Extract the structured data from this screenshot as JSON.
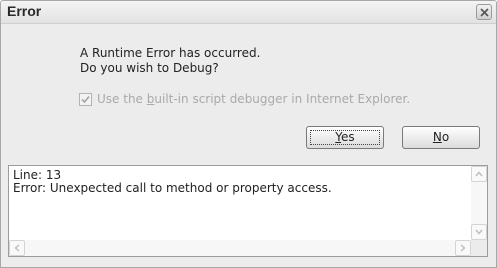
{
  "window": {
    "title": "Error"
  },
  "message": {
    "line1": "A Runtime Error has occurred.",
    "line2": "Do you wish to Debug?"
  },
  "debugger_option": {
    "label_pre": "Use the ",
    "label_hotkey": "b",
    "label_post": "uilt-in script debugger in Internet Explorer.",
    "checked": true,
    "enabled": false
  },
  "buttons": {
    "yes": {
      "hotkey": "Y",
      "rest": "es"
    },
    "no": {
      "hotkey": "N",
      "rest": "o"
    }
  },
  "details": {
    "line_label": "Line: 13",
    "error_label": "Error: Unexpected call to method or property access."
  },
  "icons": [
    "close-icon",
    "check-icon",
    "scroll-up-icon",
    "scroll-down-icon",
    "scroll-left-icon",
    "scroll-right-icon"
  ]
}
